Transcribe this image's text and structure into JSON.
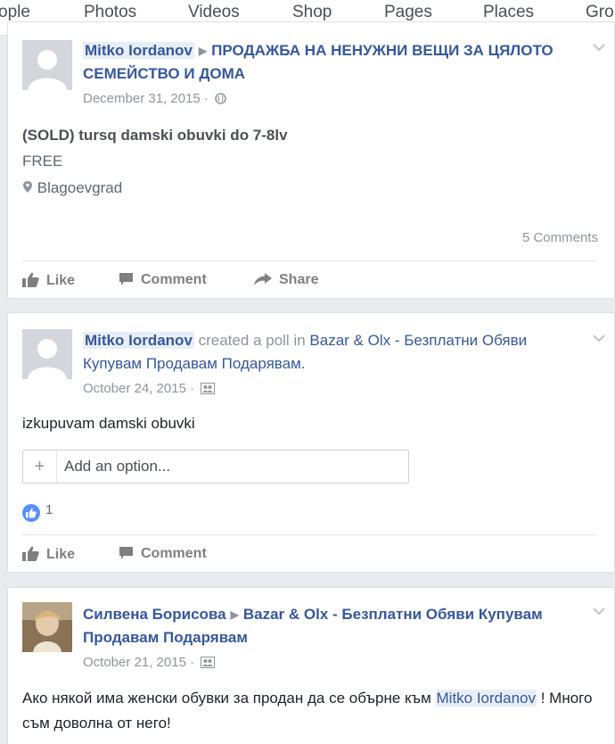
{
  "tabs": [
    "ople",
    "Photos",
    "Videos",
    "Shop",
    "Pages",
    "Places",
    "Gro"
  ],
  "posts": [
    {
      "author": "Mitko Iordanov",
      "group": "ПРОДАЖБА НА НЕНУЖНИ ВЕЩИ ЗА ЦЯЛОТО СЕМЕЙСТВО И ДОМА",
      "date": "December 31, 2015 ·",
      "privacy_icon": "globe-icon",
      "listing_title": "(SOLD) tursq damski obuvki do 7-8lv",
      "price": "FREE",
      "location": "Blagoevgrad",
      "comments_count": "5 Comments",
      "actions": [
        "Like",
        "Comment",
        "Share"
      ]
    },
    {
      "author": "Mitko Iordanov",
      "verb": "created a poll in",
      "group": "Bazar & Olx - Безплатни Обяви Купувам Продавам Подарявам.",
      "date": "October 24, 2015 ·",
      "privacy_icon": "group-icon",
      "text": "izkupuvam damski obuvki",
      "poll_placeholder": "Add an option...",
      "reactions": "1",
      "actions": [
        "Like",
        "Comment"
      ]
    },
    {
      "author": "Силвена Борисова",
      "group": "Bazar & Olx - Безплатни Обяви Купувам Продавам Подарявам",
      "date": "October 21, 2015 ·",
      "privacy_icon": "group-icon",
      "text_before": "Ако някой има женски обувки за продан да се обърне към ",
      "mention": "Mitko Iordanov",
      "text_after": " ! Много съм доволна от него!"
    }
  ],
  "colors": {
    "link": "#365899",
    "background": "#e9ebee",
    "like_blue": "#5890ff"
  }
}
